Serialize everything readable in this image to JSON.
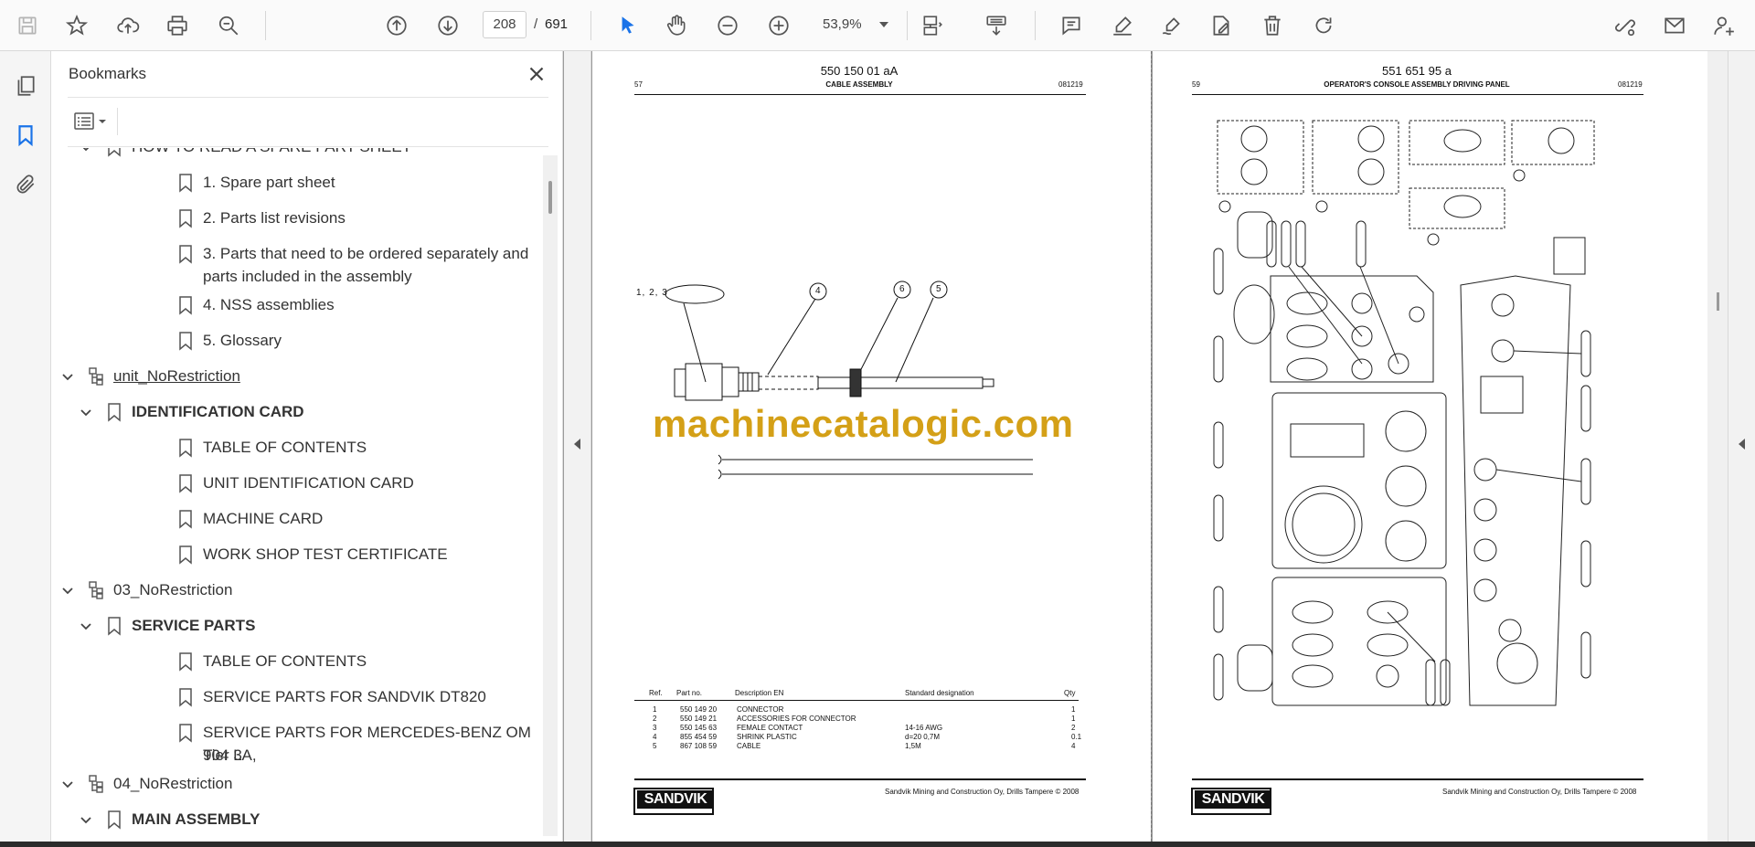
{
  "toolbar": {
    "page_current": "208",
    "page_separator": "/",
    "page_total": "691",
    "zoom": "53,9%"
  },
  "bookmarks": {
    "title": "Bookmarks",
    "items": [
      {
        "label": "HOW TO READ A SPARE PART SHEET",
        "level": 2,
        "chevron": "down",
        "icon": "bookmark-icon"
      },
      {
        "label": "1. Spare part sheet",
        "level": 3,
        "icon": "bookmark-icon"
      },
      {
        "label": "2. Parts list revisions",
        "level": 3,
        "icon": "bookmark-icon"
      },
      {
        "label": "3. Parts that need to be ordered separately and",
        "label2": "parts included in the assembly",
        "level": 3,
        "icon": "bookmark-icon"
      },
      {
        "label": "4. NSS assemblies",
        "level": 3,
        "icon": "bookmark-icon"
      },
      {
        "label": "5. Glossary",
        "level": 3,
        "icon": "bookmark-icon"
      },
      {
        "label": "unit_NoRestriction",
        "level": 1,
        "chevron": "down",
        "icon": "structure-icon"
      },
      {
        "label": "IDENTIFICATION CARD",
        "level": 2,
        "chevron": "down",
        "icon": "bookmark-icon"
      },
      {
        "label": "TABLE OF CONTENTS",
        "level": 3,
        "icon": "bookmark-icon"
      },
      {
        "label": "UNIT IDENTIFICATION CARD",
        "level": 3,
        "icon": "bookmark-icon"
      },
      {
        "label": "MACHINE CARD",
        "level": 3,
        "icon": "bookmark-icon"
      },
      {
        "label": "WORK SHOP TEST CERTIFICATE",
        "level": 3,
        "icon": "bookmark-icon"
      },
      {
        "label": "03_NoRestriction",
        "level": 1,
        "chevron": "down",
        "icon": "structure-icon"
      },
      {
        "label": "SERVICE PARTS",
        "level": 2,
        "chevron": "down",
        "icon": "bookmark-icon"
      },
      {
        "label": "TABLE OF CONTENTS",
        "level": 3,
        "icon": "bookmark-icon"
      },
      {
        "label": "SERVICE PARTS FOR SANDVIK DT820",
        "level": 3,
        "icon": "bookmark-icon"
      },
      {
        "label": "SERVICE PARTS FOR MERCEDES-BENZ OM 904 LA,",
        "label2": "Tier 3",
        "level": 3,
        "icon": "bookmark-icon"
      },
      {
        "label": "04_NoRestriction",
        "level": 1,
        "chevron": "down",
        "icon": "structure-icon"
      },
      {
        "label": "MAIN ASSEMBLY",
        "level": 2,
        "chevron": "down",
        "icon": "bookmark-icon"
      }
    ]
  },
  "left_page": {
    "doc_no": "550 150 01 aA",
    "page_no": "57",
    "title": "CABLE ASSEMBLY",
    "date": "081219",
    "callouts": [
      "1, 2, 3",
      "4",
      "6",
      "5"
    ],
    "table_headers": [
      "Ref.",
      "Part no.",
      "Description EN",
      "Standard designation",
      "Qty"
    ],
    "table_rows": [
      [
        "1",
        "550 149 20",
        "CONNECTOR",
        "",
        "1"
      ],
      [
        "2",
        "550 149 21",
        "ACCESSORIES FOR CONNECTOR",
        "",
        "1"
      ],
      [
        "3",
        "550 145 63",
        "FEMALE CONTACT",
        "14-16 AWG",
        "2"
      ],
      [
        "4",
        "855 454 59",
        "SHRINK PLASTIC",
        "d=20 0,7M",
        "0.1"
      ],
      [
        "5",
        "867 108 59",
        "CABLE",
        "1,5M",
        "4"
      ]
    ],
    "copyright": "Sandvik Mining and Construction Oy, Drills Tampere © 2008",
    "logo": "SANDVIK"
  },
  "right_page": {
    "doc_no": "551 651 95 a",
    "page_no": "59",
    "title": "OPERATOR'S CONSOLE ASSEMBLY DRIVING PANEL",
    "date": "081219",
    "copyright": "Sandvik Mining and Construction Oy, Drills Tampere © 2008",
    "logo": "SANDVIK"
  },
  "watermark": "machinecatalogic.com",
  "colors": {
    "accent_blue": "#1a73e8",
    "watermark": "#d4a017",
    "panel_bg": "#f5f5f5",
    "doc_bg": "#9a9a9a"
  }
}
